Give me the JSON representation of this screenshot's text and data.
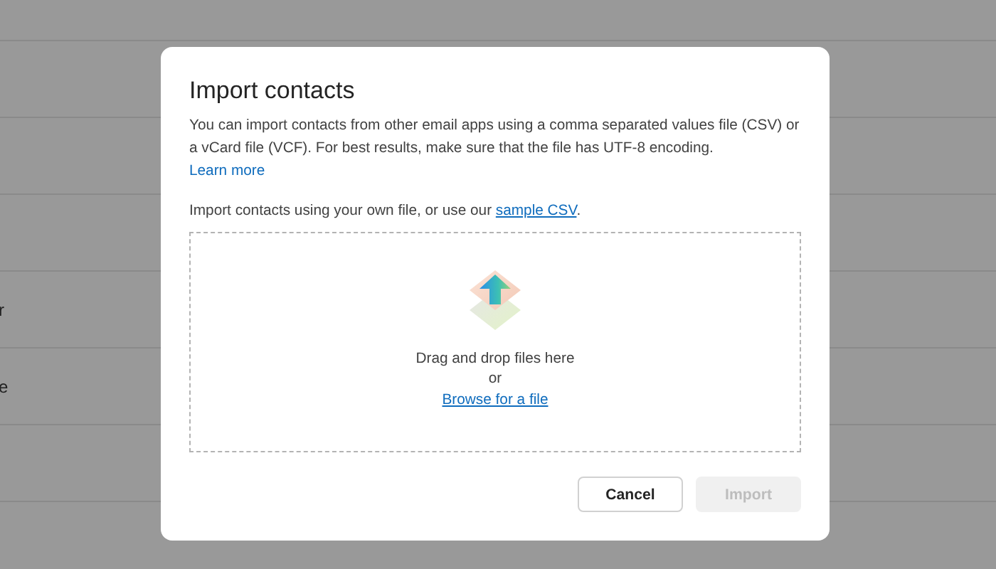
{
  "background_list": {
    "rows": [
      {
        "text": "r"
      },
      {
        "text": "e"
      }
    ]
  },
  "dialog": {
    "title": "Import contacts",
    "description": "You can import contacts from other email apps using a comma separated values file (CSV) or a vCard file (VCF). For best results, make sure that the file has UTF-8 encoding.",
    "learn_more_link": "Learn more",
    "sample_prompt": "Import contacts using your own file, or use our ",
    "sample_link": "sample CSV",
    "sample_suffix": ".",
    "dropzone": {
      "text": "Drag and drop files here",
      "or": "or",
      "browse_link": "Browse for a file"
    },
    "buttons": [
      {
        "label": "Cancel",
        "kind": "secondary",
        "disabled": false
      },
      {
        "label": "Import",
        "kind": "primary",
        "disabled": true
      }
    ]
  }
}
